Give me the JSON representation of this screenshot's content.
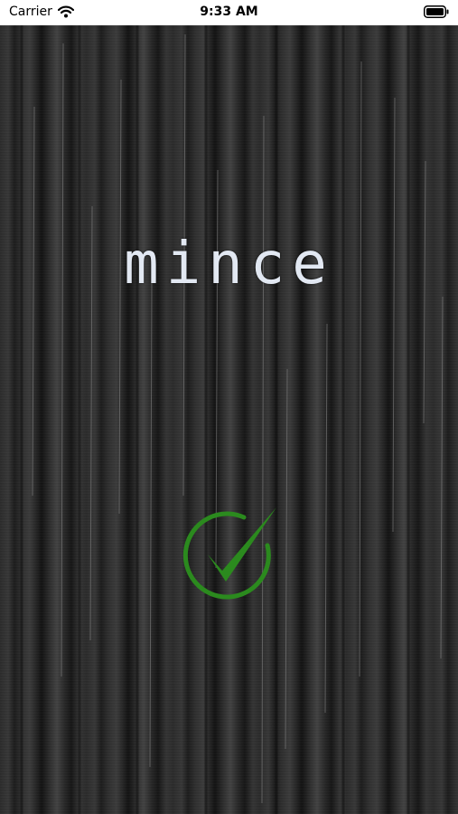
{
  "status_bar": {
    "carrier": "Carrier",
    "time": "9:33 AM",
    "wifi_icon": "wifi-icon",
    "battery_icon": "battery-icon"
  },
  "splash": {
    "logo_text": "mince",
    "logo_color": "#e2e8f2",
    "status_icon": "checkmark-circle-icon",
    "status_icon_color": "#2b8a1e"
  }
}
